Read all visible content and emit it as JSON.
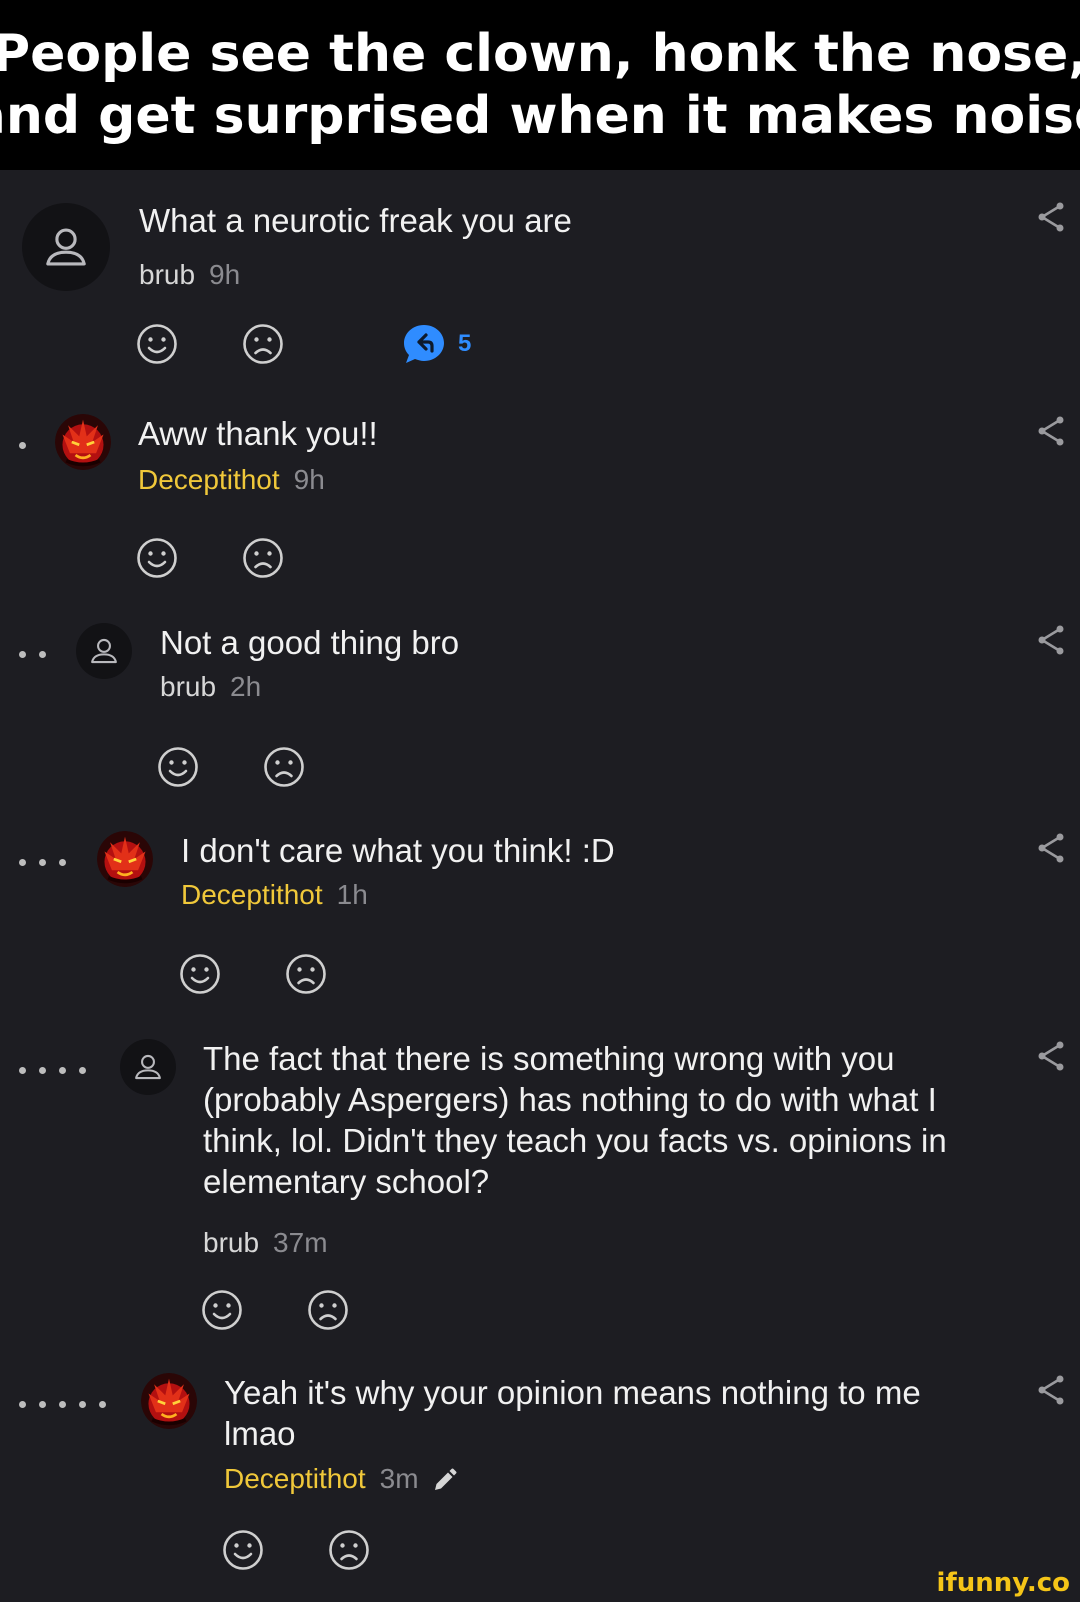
{
  "caption": {
    "line1": "People see the clown, honk the nose,",
    "line2": "and get surprised when it makes noise"
  },
  "comments": [
    {
      "text": "What a neurotic freak you are",
      "user": "brub",
      "time": "9h",
      "reply_count": "5"
    },
    {
      "text": "Aww thank you!!",
      "user": "Deceptithot",
      "time": "9h"
    },
    {
      "text": "Not a good thing bro",
      "user": "brub",
      "time": "2h"
    },
    {
      "text": "I don't care what you think! :D",
      "user": "Deceptithot",
      "time": "1h"
    },
    {
      "text": "The fact that there is something wrong with you (probably Aspergers) has nothing to do with what I think, lol. Didn't they teach you facts vs. opinions in elementary school?",
      "user": "brub",
      "time": "37m"
    },
    {
      "text": "Yeah it's why your opinion means nothing to me lmao",
      "user": "Deceptithot",
      "time": "3m"
    }
  ],
  "icons": {
    "smile": "smile-icon",
    "frown": "frown-icon",
    "reply": "reply-bubble-icon",
    "share": "share-icon",
    "edit": "pencil-icon",
    "default_avatar": "user-icon"
  },
  "colors": {
    "background": "#1d1d22",
    "username_highlight": "#f0c83a",
    "reply_count": "#2f8cff"
  },
  "watermark": "ifunny.co"
}
